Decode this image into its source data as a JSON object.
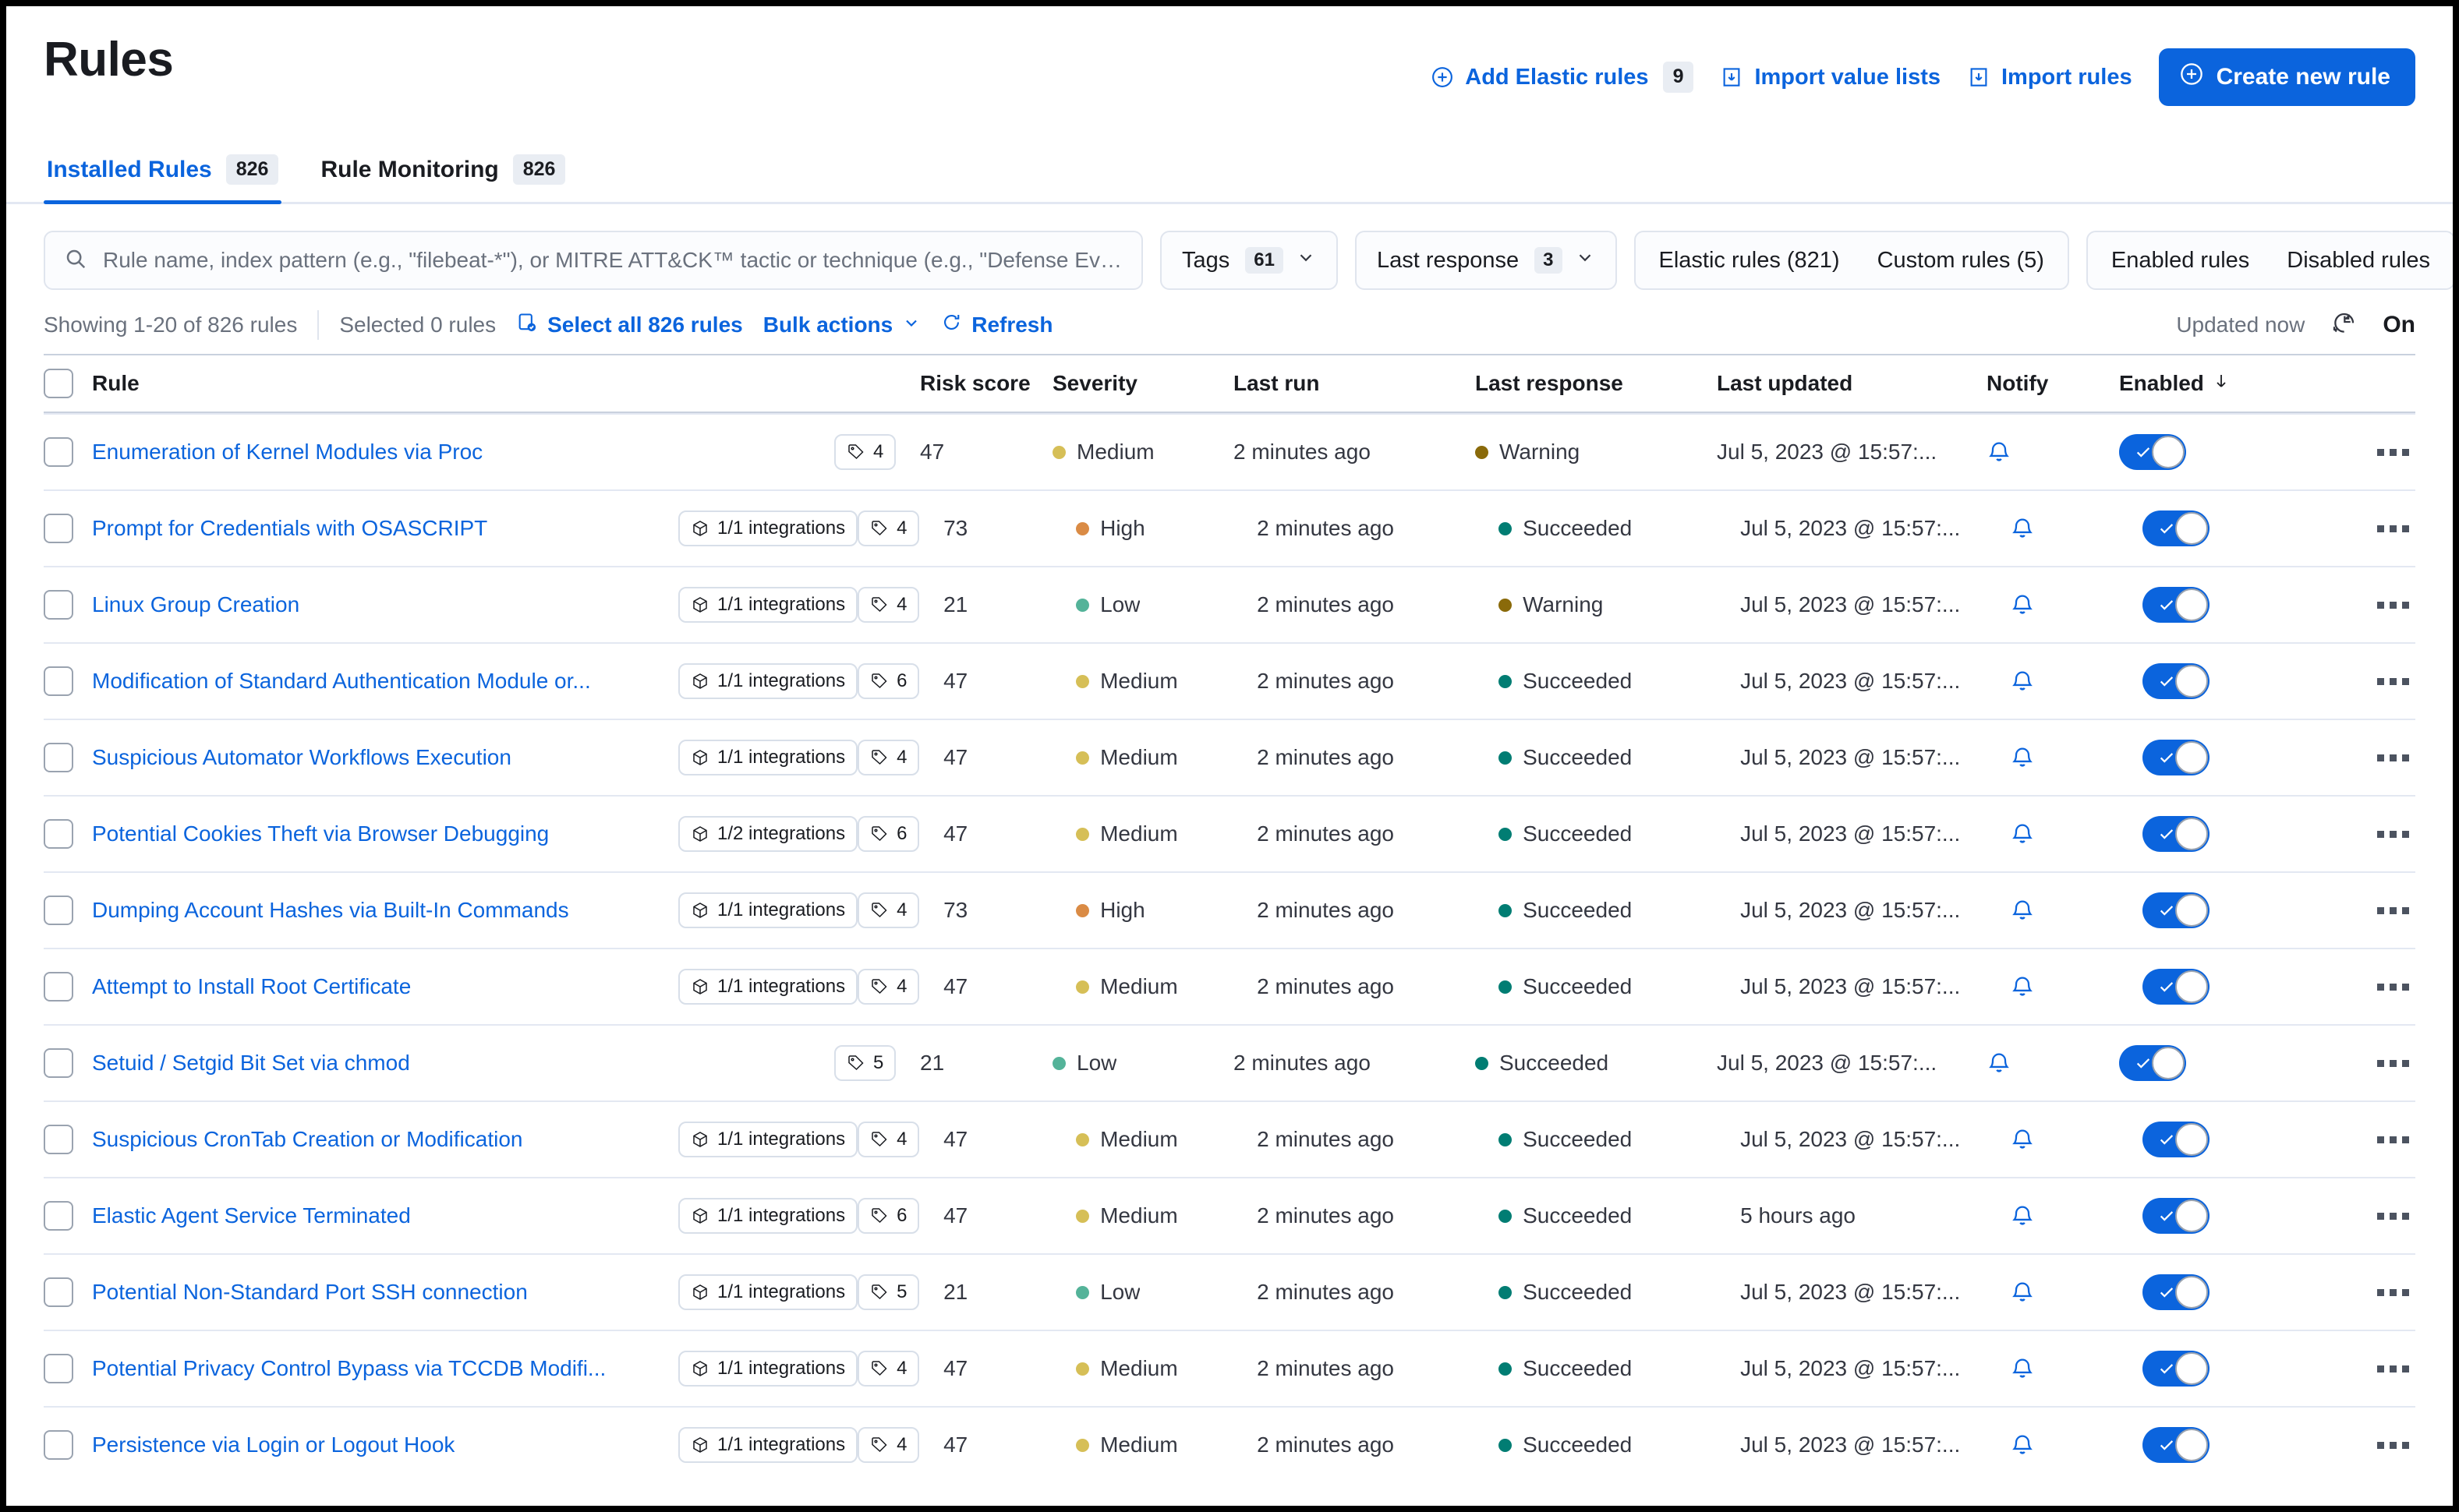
{
  "header": {
    "title": "Rules",
    "actions": [
      {
        "label": "Add Elastic rules",
        "icon": "plus-circle-icon",
        "badge": "9"
      },
      {
        "label": "Import value lists",
        "icon": "import-icon",
        "badge": null
      },
      {
        "label": "Import rules",
        "icon": "import-icon",
        "badge": null
      }
    ],
    "primary_button": {
      "label": "Create new rule",
      "icon": "plus-circle-icon"
    }
  },
  "tabs": [
    {
      "label": "Installed Rules",
      "count": "826",
      "active": true
    },
    {
      "label": "Rule Monitoring",
      "count": "826",
      "active": false
    }
  ],
  "search": {
    "placeholder": "Rule name, index pattern (e.g., \"filebeat-*\"), or MITRE ATT&CK™ tactic or technique (e.g., \"Defense Evasion\")",
    "value": "",
    "icon": "search-icon"
  },
  "filters": [
    {
      "label": "Tags",
      "count": "61",
      "icon": "chevron-down-icon"
    },
    {
      "label": "Last response",
      "count": "3",
      "icon": "chevron-down-icon"
    }
  ],
  "source_segmented": [
    {
      "label": "Elastic rules (821)"
    },
    {
      "label": "Custom rules (5)"
    }
  ],
  "state_segmented": [
    {
      "label": "Enabled rules"
    },
    {
      "label": "Disabled rules"
    }
  ],
  "toolbar": {
    "showing": "Showing 1-20 of 826 rules",
    "selected": "Selected 0 rules",
    "select_all": "Select all 826 rules",
    "select_all_icon": "select-all-icon",
    "bulk_actions": "Bulk actions",
    "bulk_actions_icon": "chevron-down-icon",
    "refresh": "Refresh",
    "refresh_icon": "refresh-icon",
    "updated": "Updated now",
    "auto_refresh_icon": "clock-refresh-icon",
    "auto_refresh_state": "On"
  },
  "table": {
    "columns": {
      "rule": "Rule",
      "risk_score": "Risk score",
      "severity": "Severity",
      "last_run": "Last run",
      "last_response": "Last response",
      "last_updated": "Last updated",
      "notify": "Notify",
      "enabled": "Enabled"
    },
    "sort_icon": "arrow-down-icon",
    "severity_colors": {
      "Low": "#54b399",
      "Medium": "#d6bf57",
      "High": "#da8b45",
      "Critical": "#e7664c"
    },
    "response_colors": {
      "Succeeded": "#017d73",
      "Warning": "#8a6a0a",
      "Failed": "#bd271e"
    },
    "rows": [
      {
        "name": "Enumeration of Kernel Modules via Proc",
        "integrations": null,
        "tags": "4",
        "risk_score": "47",
        "severity": "Medium",
        "last_run": "2 minutes ago",
        "last_response": "Warning",
        "last_updated": "Jul 5, 2023 @ 15:57:...",
        "notify": "bell-icon",
        "enabled": true
      },
      {
        "name": "Prompt for Credentials with OSASCRIPT",
        "integrations": "1/1 integrations",
        "tags": "4",
        "risk_score": "73",
        "severity": "High",
        "last_run": "2 minutes ago",
        "last_response": "Succeeded",
        "last_updated": "Jul 5, 2023 @ 15:57:...",
        "notify": "bell-icon",
        "enabled": true
      },
      {
        "name": "Linux Group Creation",
        "integrations": "1/1 integrations",
        "tags": "4",
        "risk_score": "21",
        "severity": "Low",
        "last_run": "2 minutes ago",
        "last_response": "Warning",
        "last_updated": "Jul 5, 2023 @ 15:57:...",
        "notify": "bell-icon",
        "enabled": true
      },
      {
        "name": "Modification of Standard Authentication Module or...",
        "integrations": "1/1 integrations",
        "tags": "6",
        "risk_score": "47",
        "severity": "Medium",
        "last_run": "2 minutes ago",
        "last_response": "Succeeded",
        "last_updated": "Jul 5, 2023 @ 15:57:...",
        "notify": "bell-icon",
        "enabled": true
      },
      {
        "name": "Suspicious Automator Workflows Execution",
        "integrations": "1/1 integrations",
        "tags": "4",
        "risk_score": "47",
        "severity": "Medium",
        "last_run": "2 minutes ago",
        "last_response": "Succeeded",
        "last_updated": "Jul 5, 2023 @ 15:57:...",
        "notify": "bell-icon",
        "enabled": true
      },
      {
        "name": "Potential Cookies Theft via Browser Debugging",
        "integrations": "1/2 integrations",
        "tags": "6",
        "risk_score": "47",
        "severity": "Medium",
        "last_run": "2 minutes ago",
        "last_response": "Succeeded",
        "last_updated": "Jul 5, 2023 @ 15:57:...",
        "notify": "bell-icon",
        "enabled": true
      },
      {
        "name": "Dumping Account Hashes via Built-In Commands",
        "integrations": "1/1 integrations",
        "tags": "4",
        "risk_score": "73",
        "severity": "High",
        "last_run": "2 minutes ago",
        "last_response": "Succeeded",
        "last_updated": "Jul 5, 2023 @ 15:57:...",
        "notify": "bell-icon",
        "enabled": true
      },
      {
        "name": "Attempt to Install Root Certificate",
        "integrations": "1/1 integrations",
        "tags": "4",
        "risk_score": "47",
        "severity": "Medium",
        "last_run": "2 minutes ago",
        "last_response": "Succeeded",
        "last_updated": "Jul 5, 2023 @ 15:57:...",
        "notify": "bell-icon",
        "enabled": true
      },
      {
        "name": "Setuid / Setgid Bit Set via chmod",
        "integrations": null,
        "tags": "5",
        "risk_score": "21",
        "severity": "Low",
        "last_run": "2 minutes ago",
        "last_response": "Succeeded",
        "last_updated": "Jul 5, 2023 @ 15:57:...",
        "notify": "bell-icon",
        "enabled": true
      },
      {
        "name": "Suspicious CronTab Creation or Modification",
        "integrations": "1/1 integrations",
        "tags": "4",
        "risk_score": "47",
        "severity": "Medium",
        "last_run": "2 minutes ago",
        "last_response": "Succeeded",
        "last_updated": "Jul 5, 2023 @ 15:57:...",
        "notify": "bell-icon",
        "enabled": true
      },
      {
        "name": "Elastic Agent Service Terminated",
        "integrations": "1/1 integrations",
        "tags": "6",
        "risk_score": "47",
        "severity": "Medium",
        "last_run": "2 minutes ago",
        "last_response": "Succeeded",
        "last_updated": "5 hours ago",
        "notify": "bell-icon",
        "enabled": true
      },
      {
        "name": "Potential Non-Standard Port SSH connection",
        "integrations": "1/1 integrations",
        "tags": "5",
        "risk_score": "21",
        "severity": "Low",
        "last_run": "2 minutes ago",
        "last_response": "Succeeded",
        "last_updated": "Jul 5, 2023 @ 15:57:...",
        "notify": "bell-icon",
        "enabled": true
      },
      {
        "name": "Potential Privacy Control Bypass via TCCDB Modifi...",
        "integrations": "1/1 integrations",
        "tags": "4",
        "risk_score": "47",
        "severity": "Medium",
        "last_run": "2 minutes ago",
        "last_response": "Succeeded",
        "last_updated": "Jul 5, 2023 @ 15:57:...",
        "notify": "bell-icon",
        "enabled": true
      },
      {
        "name": "Persistence via Login or Logout Hook",
        "integrations": "1/1 integrations",
        "tags": "4",
        "risk_score": "47",
        "severity": "Medium",
        "last_run": "2 minutes ago",
        "last_response": "Succeeded",
        "last_updated": "Jul 5, 2023 @ 15:57:...",
        "notify": "bell-icon",
        "enabled": true
      }
    ]
  },
  "colors": {
    "accent": "#0b64dd",
    "text": "#1a1c21",
    "muted": "#6a717d",
    "border": "#e3e8f2"
  }
}
